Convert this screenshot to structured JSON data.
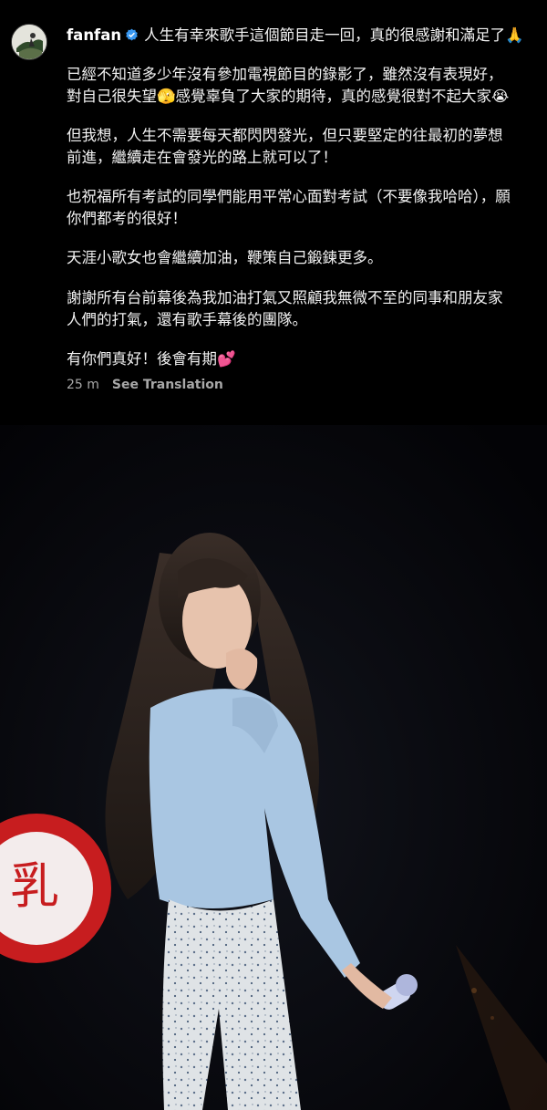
{
  "post": {
    "username": "fanfan",
    "verified": true,
    "first_line": "人生有幸來歌手這個節目走一回，真的很感謝和滿足了🙏",
    "paragraphs": [
      "已經不知道多少年沒有參加電視節目的錄影了，雖然沒有表現好，\n對自己很失望🫣感覺辜負了大家的期待，真的感覺很對不起大家😭",
      "但我想，人生不需要每天都閃閃發光，但只要堅定的往最初的夢想\n前進，繼續走在會發光的路上就可以了！",
      "也祝福所有考試的同學們能用平常心面對考試（不要像我哈哈），願\n你們都考的很好！",
      "天涯小歌女也會繼續加油，鞭策自己鍛鍊更多。",
      "謝謝所有台前幕後為我加油打氣又照顧我無微不至的同事和朋友家\n人們的打氣，還有歌手幕後的團隊。",
      "有你們真好！後會有期💕"
    ],
    "timestamp": "25 m",
    "see_translation": "See Translation"
  },
  "photo": {
    "sign_text": "乳"
  },
  "colors": {
    "background": "#000000",
    "verified_blue": "#3897f0",
    "meta_gray": "#a8a8a8",
    "sweater_blue": "#a9c6e2"
  }
}
